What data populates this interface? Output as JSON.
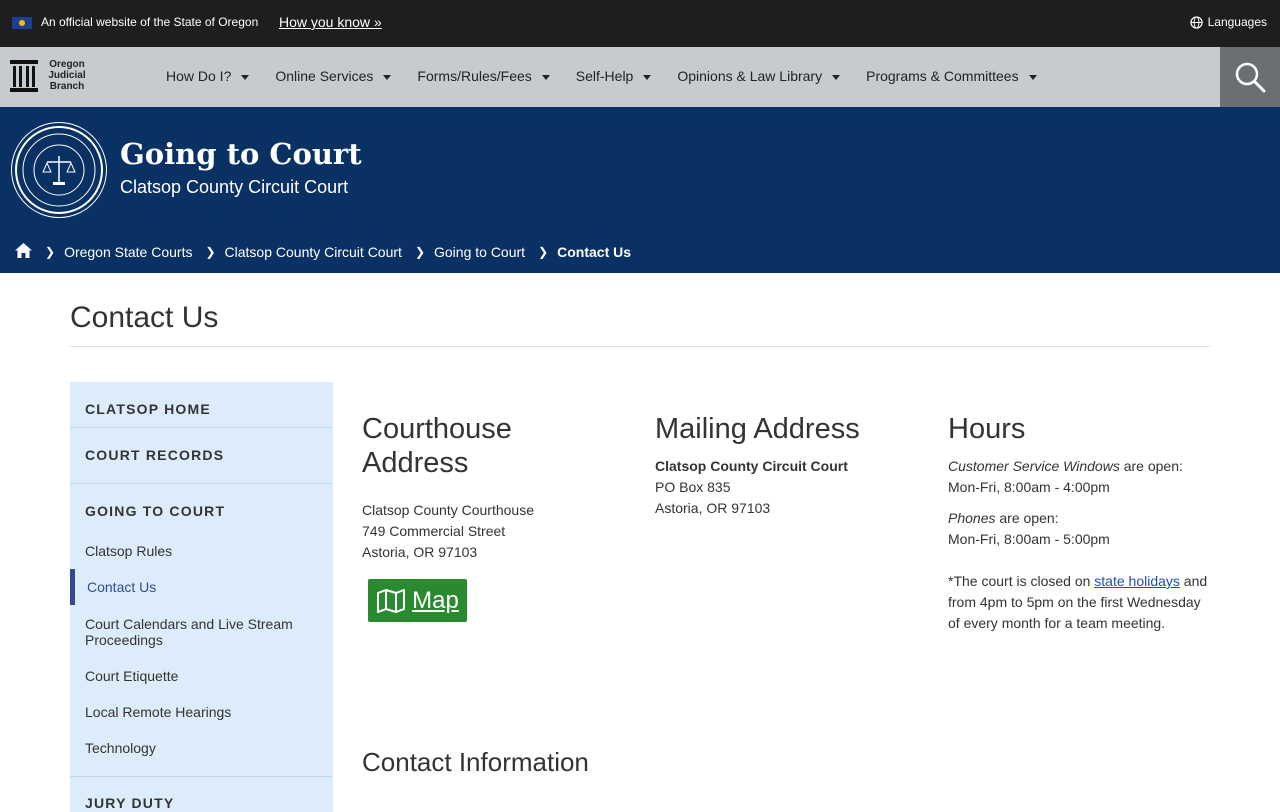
{
  "topbar": {
    "official_text": "An official website of the State of Oregon",
    "how_you_know": "How you know »",
    "languages": "Languages"
  },
  "nav": {
    "logo_text": [
      "Oregon",
      "Judicial",
      "Branch"
    ],
    "menu": [
      "How Do I?",
      "Online Services",
      "Forms/Rules/Fees",
      "Self-Help",
      "Opinions & Law Library",
      "Programs & Committees"
    ]
  },
  "hero": {
    "title": "Going to Court",
    "subtitle": "Clatsop County Circuit Court"
  },
  "breadcrumb": [
    "Oregon State Courts",
    "Clatsop County Circuit Court",
    "Going to Court",
    "Contact Us"
  ],
  "page": {
    "title": "Contact Us"
  },
  "sidebar": {
    "sections": [
      "CLATSOP HOME",
      "COURT RECORDS",
      "GOING TO COURT",
      "JURY DUTY"
    ],
    "items": [
      "Clatsop Rules",
      "Contact Us",
      "Court Calendars and Live Stream Proceedings",
      "Court Etiquette",
      "Local Remote Hearings",
      "Technology"
    ]
  },
  "courthouse": {
    "heading": "Courthouse Address",
    "lines": [
      "Clatsop County Courthouse",
      "749 Commercial Street",
      "Astoria, OR 97103"
    ],
    "map_label": "Map"
  },
  "mailing": {
    "heading": "Mailing Address",
    "name": "Clatsop County Circuit Court",
    "lines": [
      "PO Box 835",
      "Astoria, OR 97103"
    ]
  },
  "hours": {
    "heading": "Hours",
    "csw_em": "Customer Service Windows",
    "csw_rest": " are open:",
    "csw_time": "Mon-Fri, 8:00am - 4:00pm",
    "phones_em": "Phones",
    "phones_rest": " are open:",
    "phones_time": "Mon-Fri, 8:00am - 5:00pm",
    "closed_pre": "*The court is closed on ",
    "closed_link": "state holidays",
    "closed_post": " and from 4pm to 5pm on the first Wednesday of every month for a team meeting."
  },
  "contact": {
    "heading": "Contact Information"
  },
  "colors": {
    "top_bar": "#1e1e1e",
    "nav": "#c7cbd0",
    "hero": "#0a3164",
    "sidebar": "#dcecfb",
    "map_button": "#2a8a2f",
    "link": "#1f4fae"
  }
}
